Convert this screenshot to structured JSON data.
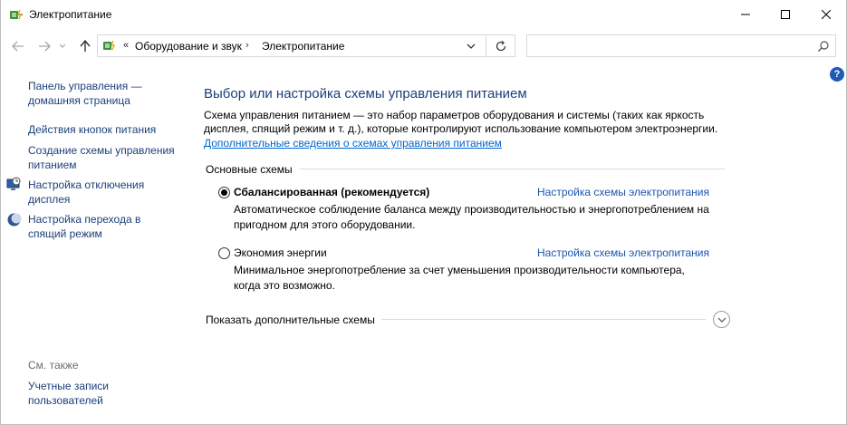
{
  "window": {
    "title": "Электропитание",
    "controls": {
      "minimize_icon": "minimize-icon",
      "maximize_icon": "maximize-icon",
      "close_icon": "close-icon"
    }
  },
  "address_bar": {
    "overflow_chevron": "«",
    "breadcrumbs": [
      "Оборудование и звук",
      "Электропитание"
    ],
    "separator": "›",
    "search_placeholder": ""
  },
  "left_pane": {
    "home_link": "Панель управления — домашняя страница",
    "links": [
      "Действия кнопок питания",
      "Создание схемы управления питанием",
      "Настройка отключения дисплея",
      "Настройка перехода в спящий режим"
    ],
    "see_also_label": "См. также",
    "see_also_links": [
      "Учетные записи пользователей"
    ]
  },
  "main": {
    "title": "Выбор или настройка схемы управления питанием",
    "description": "Схема управления питанием — это набор параметров оборудования и системы (таких как яркость дисплея, спящий режим и т. д.), которые контролируют использование компьютером электроэнергии.",
    "more_info_link": "Дополнительные сведения о схемах управления питанием",
    "group_title": "Основные схемы",
    "plans": [
      {
        "name": "Сбалансированная (рекомендуется)",
        "selected": true,
        "link": "Настройка схемы электропитания",
        "description": "Автоматическое соблюдение баланса между производительностью и энергопотреблением на пригодном для этого оборудовании."
      },
      {
        "name": "Экономия энергии",
        "selected": false,
        "link": "Настройка схемы электропитания",
        "description": "Минимальное энергопотребление за счет уменьшения производительности компьютера, когда это возможно."
      }
    ],
    "show_more_label": "Показать дополнительные схемы"
  },
  "help_label": "?",
  "colors": {
    "link": "#1b56b0",
    "heading": "#1e3d7c",
    "nav_link": "#1b3f7a",
    "help_badge": "#1f5bb5"
  }
}
